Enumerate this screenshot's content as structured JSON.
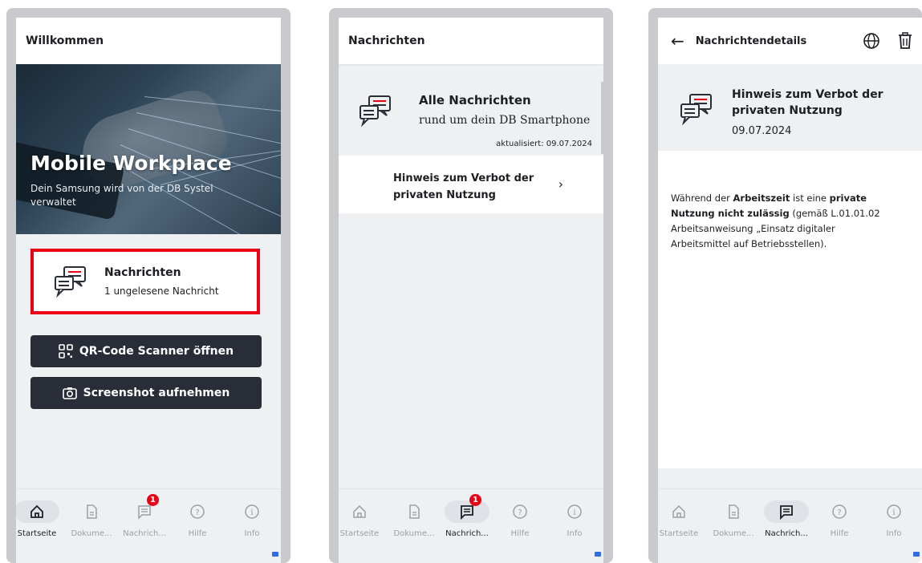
{
  "screen1": {
    "title": "Willkommen",
    "hero_title": "Mobile Workplace",
    "hero_subtitle": "Dein Samsung wird von der DB Systel verwaltet",
    "messages_card": {
      "title": "Nachrichten",
      "subtitle": "1 ungelesene Nachricht"
    },
    "qr_button": "QR-Code Scanner öffnen",
    "screenshot_button": "Screenshot aufnehmen"
  },
  "screen2": {
    "title": "Nachrichten",
    "all_messages": {
      "title": "Alle Nachrichten",
      "subtitle": "rund um dein DB Smartphone",
      "updated": "aktualisiert: 09.07.2024"
    },
    "message_item": "Hinweis zum Verbot der privaten Nutzung"
  },
  "screen3": {
    "title": "Nachrichtendetails",
    "heading": "Hinweis zum Verbot der privaten Nutzung",
    "date": "09.07.2024",
    "body": {
      "p1": "Während der ",
      "b1": "Arbeitszeit",
      "p2": " ist eine ",
      "b2": "private Nutzung nicht zulässig",
      "p3": " (gemäß L.01.01.02 Arbeitsanweisung „Einsatz digitaler Arbeitsmittel auf Betriebsstellen)."
    }
  },
  "nav": {
    "screen1": [
      "Startseite",
      "Dokume...",
      "Nachrich...",
      "Hilfe",
      "Info"
    ],
    "screen2": [
      "Startseite",
      "Dokume...",
      "Nachrich...",
      "Hilfe",
      "Info"
    ],
    "screen3": [
      "Startseite",
      "Dokume...",
      "Nachrich...",
      "Hilfe",
      "Info"
    ],
    "badge": "1"
  },
  "colors": {
    "accent_red": "#ec0016",
    "dark_button": "#282d37",
    "background": "#eef0f2"
  }
}
